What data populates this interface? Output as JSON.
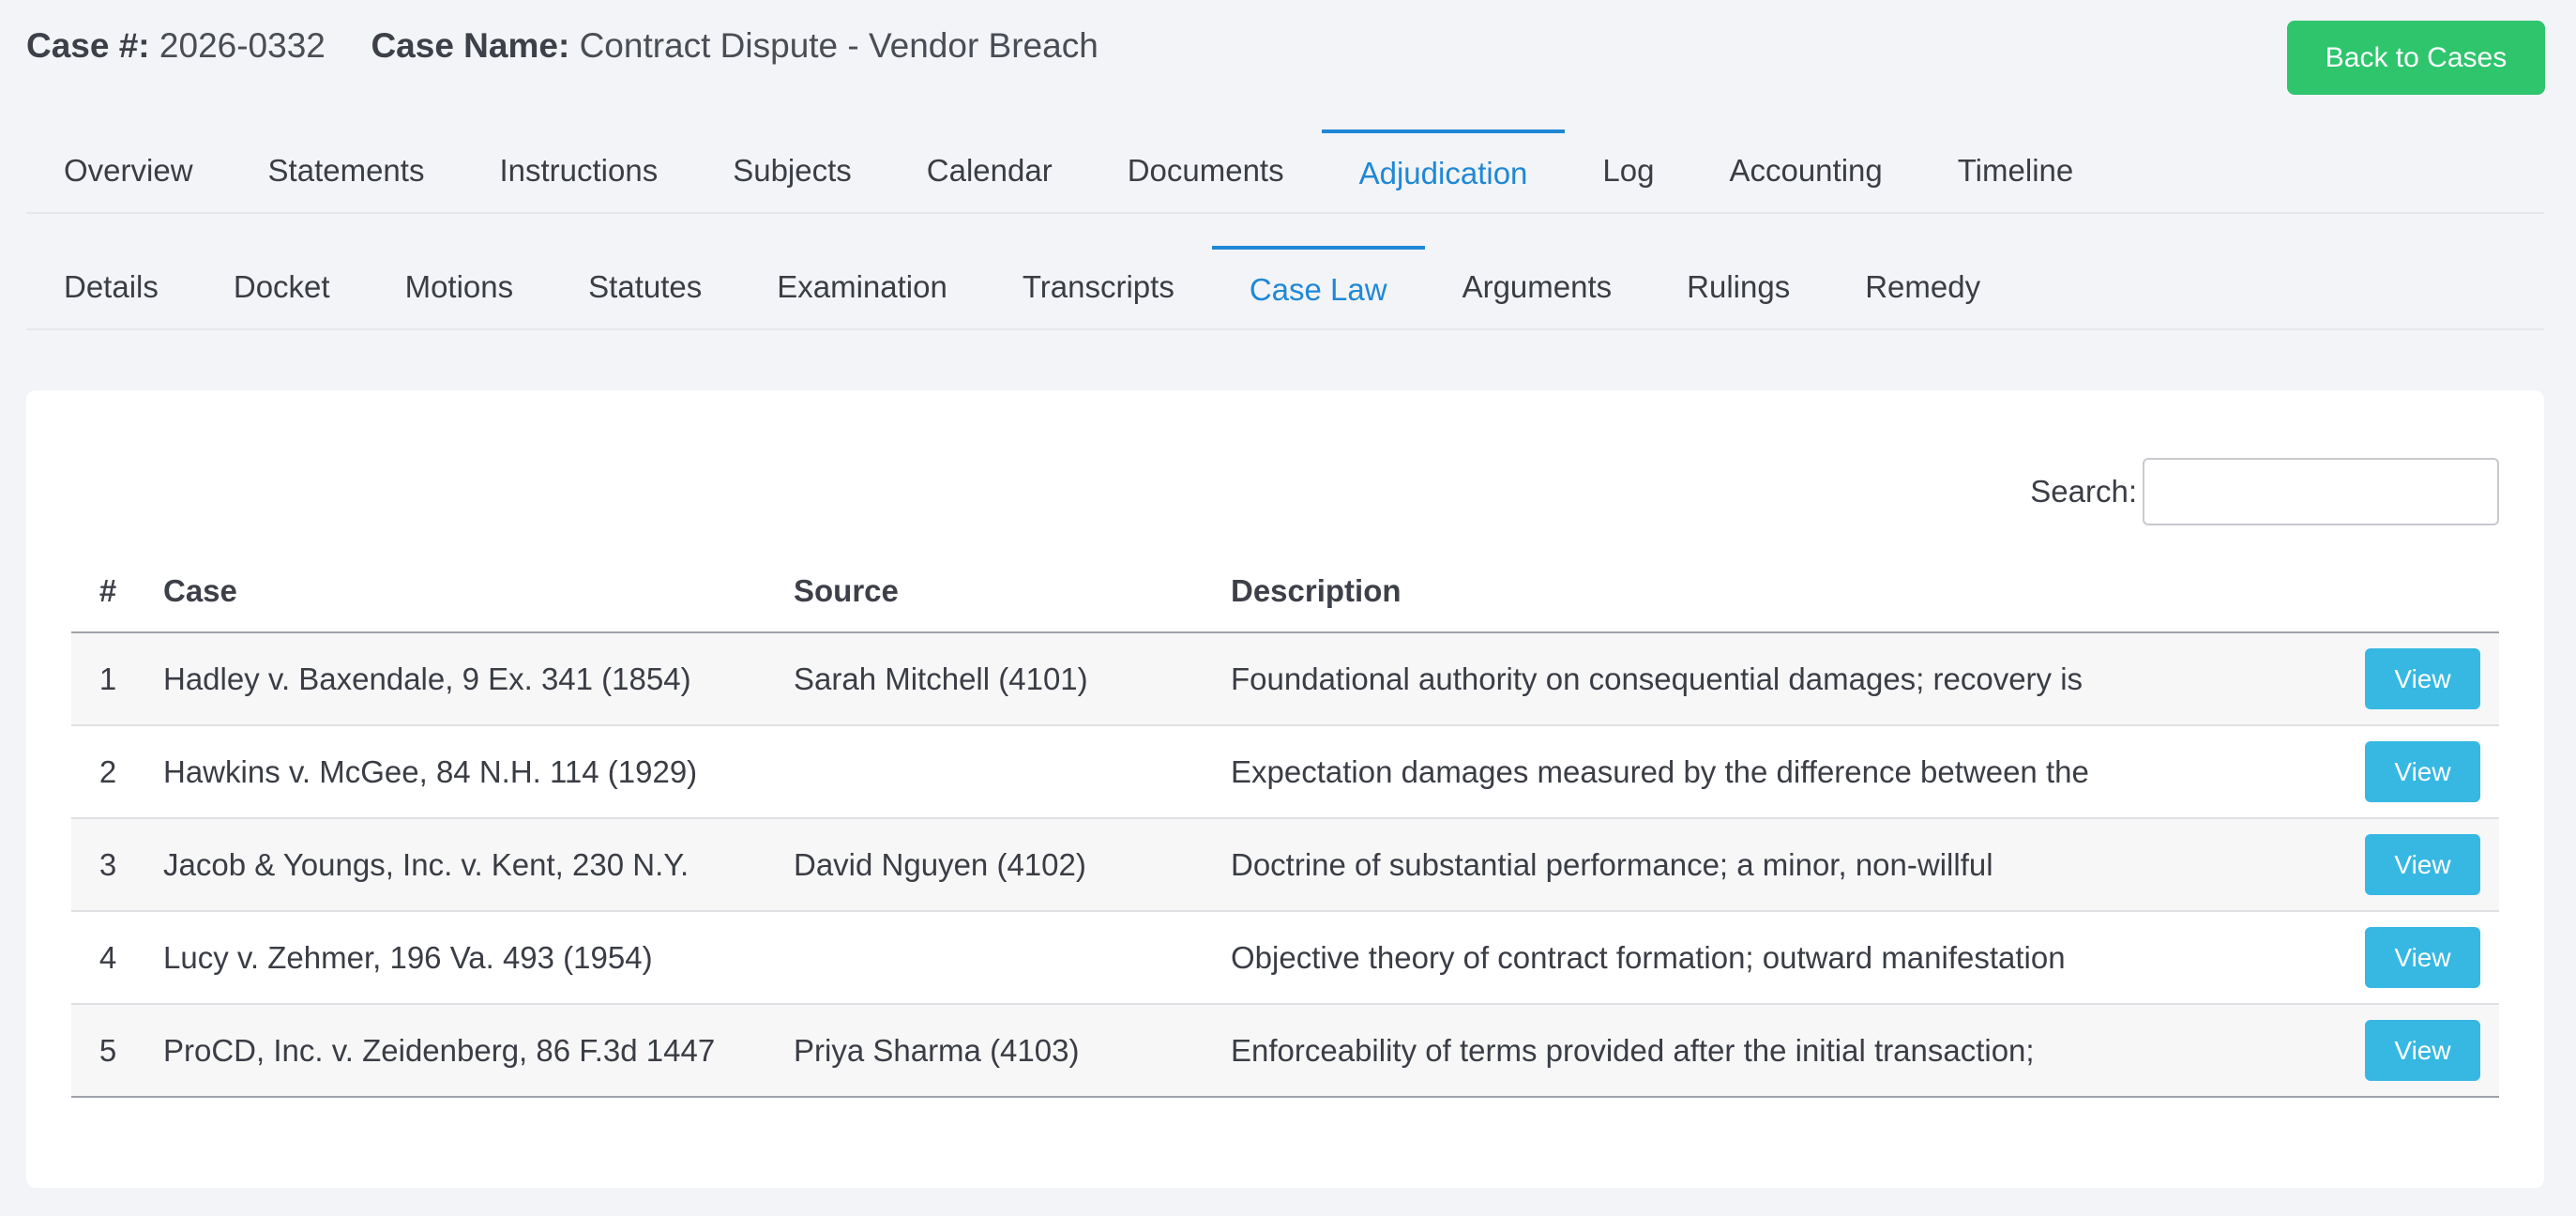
{
  "header": {
    "case_number_label": "Case #:",
    "case_number": "2026-0332",
    "case_name_label": "Case Name:",
    "case_name": "Contract Dispute - Vendor Breach",
    "back_button": "Back to Cases"
  },
  "main_tabs": [
    {
      "label": "Overview",
      "active": false
    },
    {
      "label": "Statements",
      "active": false
    },
    {
      "label": "Instructions",
      "active": false
    },
    {
      "label": "Subjects",
      "active": false
    },
    {
      "label": "Calendar",
      "active": false
    },
    {
      "label": "Documents",
      "active": false
    },
    {
      "label": "Adjudication",
      "active": true
    },
    {
      "label": "Log",
      "active": false
    },
    {
      "label": "Accounting",
      "active": false
    },
    {
      "label": "Timeline",
      "active": false
    }
  ],
  "sub_tabs": [
    {
      "label": "Details",
      "active": false
    },
    {
      "label": "Docket",
      "active": false
    },
    {
      "label": "Motions",
      "active": false
    },
    {
      "label": "Statutes",
      "active": false
    },
    {
      "label": "Examination",
      "active": false
    },
    {
      "label": "Transcripts",
      "active": false
    },
    {
      "label": "Case Law",
      "active": true
    },
    {
      "label": "Arguments",
      "active": false
    },
    {
      "label": "Rulings",
      "active": false
    },
    {
      "label": "Remedy",
      "active": false
    }
  ],
  "search": {
    "label": "Search:",
    "value": "",
    "placeholder": ""
  },
  "table": {
    "headers": {
      "num": "#",
      "case": "Case",
      "source": "Source",
      "description": "Description"
    },
    "action_label": "View",
    "rows": [
      {
        "num": "1",
        "case": "Hadley v. Baxendale, 9 Ex. 341 (1854)",
        "source": "Sarah Mitchell (4101)",
        "description": "Foundational authority on consequential damages; recovery is"
      },
      {
        "num": "2",
        "case": "Hawkins v. McGee, 84 N.H. 114 (1929)",
        "source": "",
        "description": "Expectation damages measured by the difference between the"
      },
      {
        "num": "3",
        "case": "Jacob & Youngs, Inc. v. Kent, 230 N.Y.",
        "source": "David Nguyen (4102)",
        "description": "Doctrine of substantial performance; a minor, non-willful"
      },
      {
        "num": "4",
        "case": "Lucy v. Zehmer, 196 Va. 493 (1954)",
        "source": "",
        "description": "Objective theory of contract formation; outward manifestation"
      },
      {
        "num": "5",
        "case": "ProCD, Inc. v. Zeidenberg, 86 F.3d 1447",
        "source": "Priya Sharma (4103)",
        "description": "Enforceability of terms provided after the initial transaction;"
      }
    ]
  },
  "colors": {
    "accent": "#1f88d6",
    "back_button": "#2ec56d",
    "view_button": "#36b8e3",
    "background": "#f3f4f7"
  }
}
